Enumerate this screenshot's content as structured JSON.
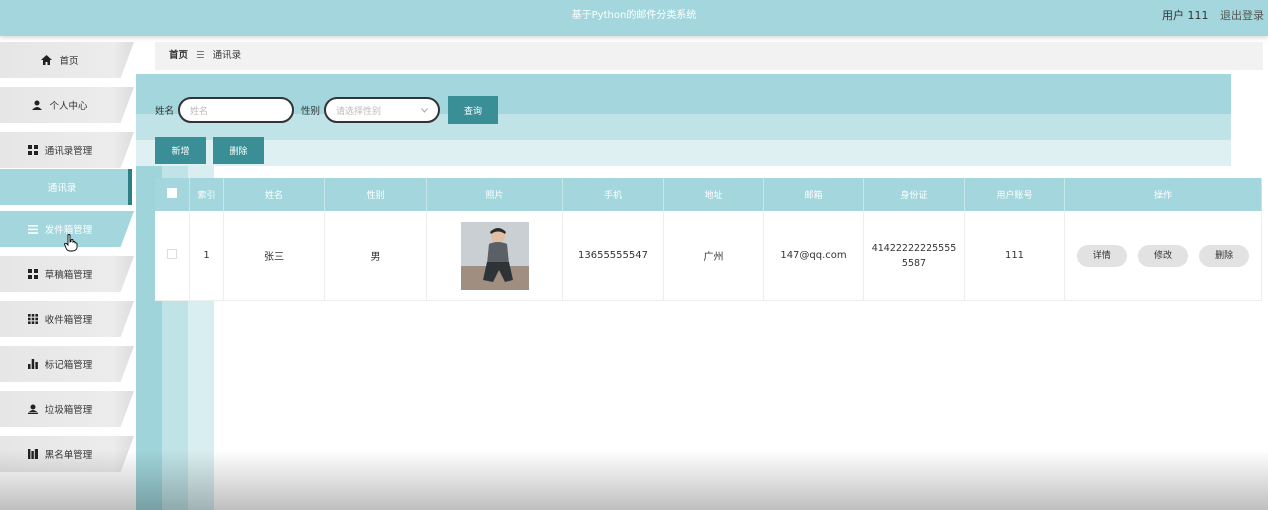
{
  "header": {
    "title": "基于Python的邮件分类系统",
    "user_label": "用户 111",
    "logout_label": "退出登录"
  },
  "sidebar": {
    "items": [
      {
        "label": "首页",
        "icon": "home-icon"
      },
      {
        "label": "个人中心",
        "icon": "user-icon"
      },
      {
        "label": "通讯录管理",
        "icon": "grid-icon"
      },
      {
        "label": "通讯录",
        "icon": ""
      },
      {
        "label": "发件箱管理",
        "icon": "list-icon"
      },
      {
        "label": "草稿箱管理",
        "icon": "grid-icon"
      },
      {
        "label": "收件箱管理",
        "icon": "grid9-icon"
      },
      {
        "label": "标记箱管理",
        "icon": "bar-chart-icon"
      },
      {
        "label": "垃圾箱管理",
        "icon": "user-upload-icon"
      },
      {
        "label": "黑名单管理",
        "icon": "library-icon"
      }
    ]
  },
  "breadcrumb": {
    "home": "首页",
    "separator": "☰",
    "current": "通讯录"
  },
  "search": {
    "name_label": "姓名",
    "name_placeholder": "姓名",
    "gender_label": "性别",
    "gender_placeholder": "请选择性别",
    "query_label": "查询"
  },
  "actions": {
    "add_label": "新增",
    "delete_label": "删除"
  },
  "table": {
    "headers": [
      "索引",
      "姓名",
      "性别",
      "照片",
      "手机",
      "地址",
      "邮箱",
      "身份证",
      "用户账号",
      "操作"
    ],
    "rows": [
      {
        "index": "1",
        "name": "张三",
        "gender": "男",
        "phone": "13655555547",
        "address": "广州",
        "email": "147@qq.com",
        "id_card": "414222222255555587",
        "account": "111"
      }
    ],
    "op_labels": {
      "detail": "详情",
      "edit": "修改",
      "delete": "删除"
    }
  },
  "colors": {
    "accent": "#a3d7dd",
    "button": "#3a8f97"
  }
}
